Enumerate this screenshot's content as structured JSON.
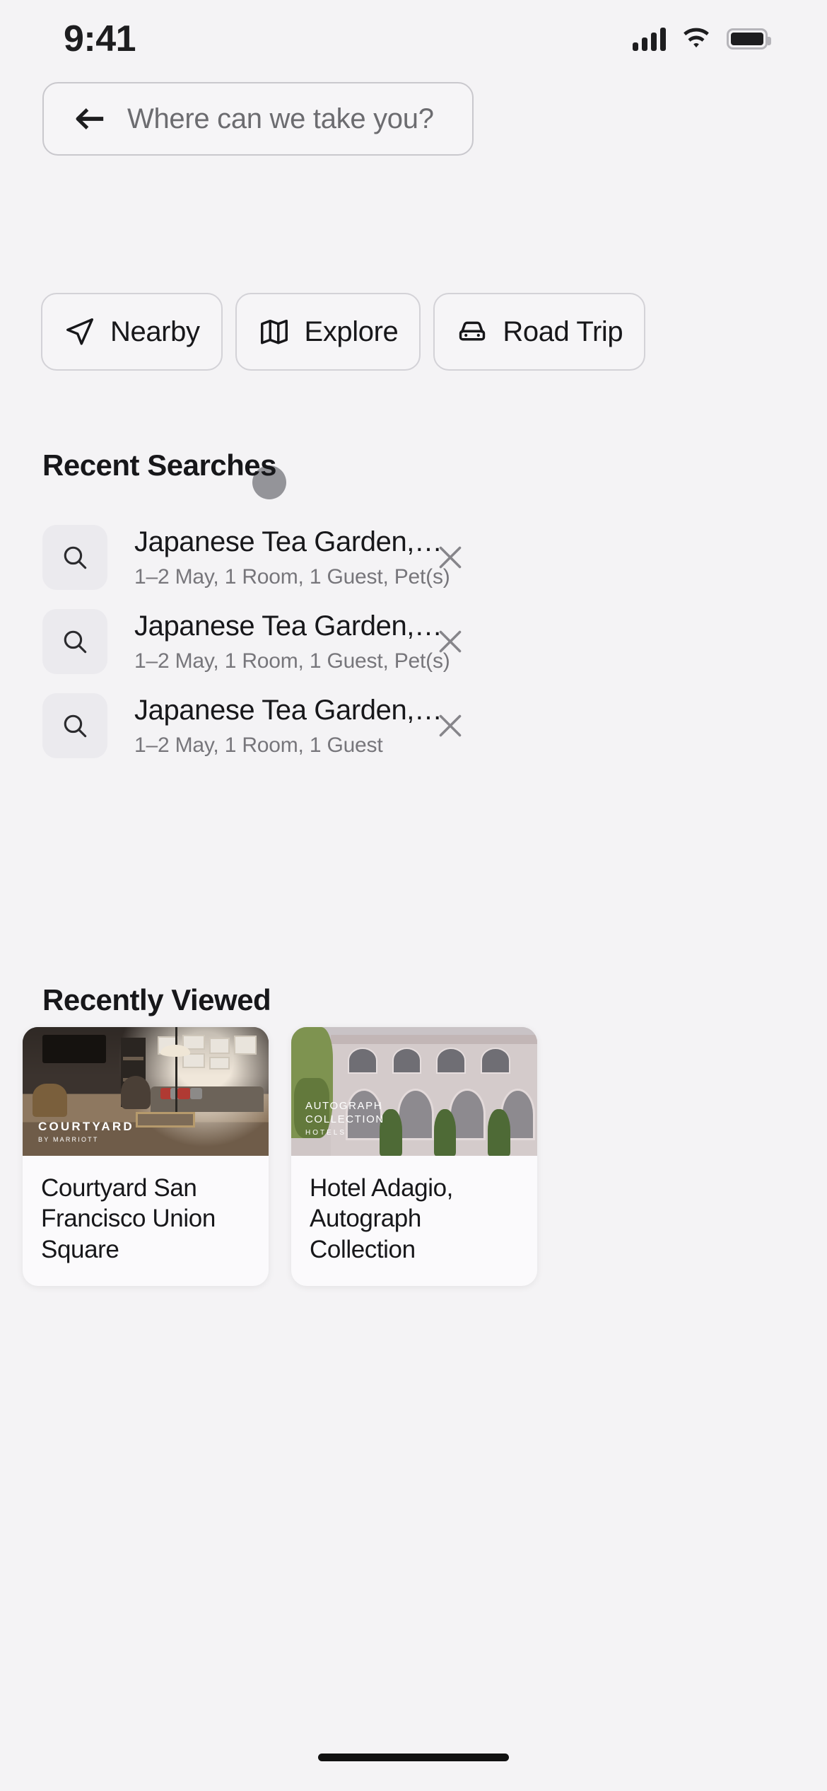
{
  "status_bar": {
    "time": "9:41",
    "cellular_icon": "cellular-bars-icon",
    "wifi_icon": "wifi-icon",
    "battery_icon": "battery-full-icon"
  },
  "search": {
    "back_icon": "back-arrow-icon",
    "placeholder": "Where can we take you?",
    "value": ""
  },
  "chips": [
    {
      "label": "Nearby",
      "icon": "navigation-arrow-icon"
    },
    {
      "label": "Explore",
      "icon": "map-icon"
    },
    {
      "label": "Road Trip",
      "icon": "car-front-icon"
    }
  ],
  "cursor": {
    "name": "touch-indicator",
    "over": "Explore"
  },
  "recent": {
    "title": "Recent Searches",
    "items": [
      {
        "icon": "search-icon",
        "title": "Japanese Tea Garden,…",
        "subtitle": "1–2 May, 1 Room, 1 Guest, Pet(s)",
        "remove_icon": "close-icon"
      },
      {
        "icon": "search-icon",
        "title": "Japanese Tea Garden,…",
        "subtitle": "1–2 May, 1 Room, 1 Guest, Pet(s)",
        "remove_icon": "close-icon"
      },
      {
        "icon": "search-icon",
        "title": "Japanese Tea Garden,…",
        "subtitle": "1–2 May, 1 Room, 1 Guest",
        "remove_icon": "close-icon"
      }
    ]
  },
  "recently_viewed": {
    "title": "Recently Viewed",
    "cards": [
      {
        "name": "Courtyard San Francisco Union Square",
        "brand_line1": "COURTYARD",
        "brand_line2": "BY MARRIOTT"
      },
      {
        "name": "Hotel Adagio, Autograph Collection",
        "brand_line1": "AUTOGRAPH",
        "brand_line2": "COLLECTION",
        "brand_line3": "HOTELS"
      }
    ]
  },
  "colors": {
    "background": "#f4f3f5",
    "text_primary": "#17171a",
    "text_secondary": "#77767b",
    "border": "#d3d2d7",
    "cursor": "#8e8e93"
  }
}
